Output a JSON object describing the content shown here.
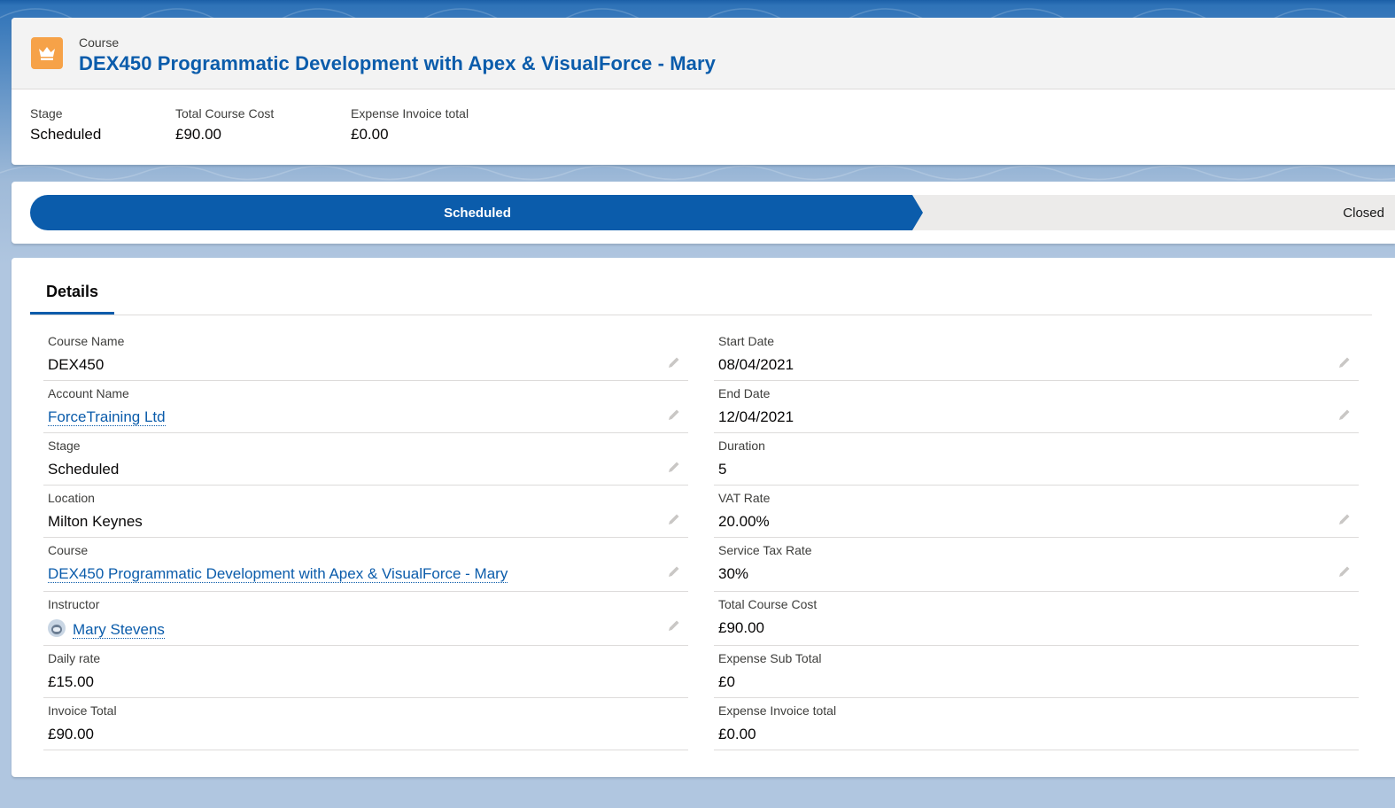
{
  "colors": {
    "brand_blue": "#0b5cab",
    "icon_orange": "#f6a248",
    "path_inactive": "#ecebea"
  },
  "header": {
    "object_icon": "crown-icon",
    "object_type": "Course",
    "title": "DEX450 Programmatic Development with Apex & VisualForce - Mary",
    "highlights": [
      {
        "label": "Stage",
        "value": "Scheduled"
      },
      {
        "label": "Total Course Cost",
        "value": "£90.00"
      },
      {
        "label": "Expense Invoice total",
        "value": "£0.00"
      }
    ]
  },
  "path": {
    "stages": [
      {
        "label": "Scheduled",
        "state": "current"
      },
      {
        "label": "Closed",
        "state": "incomplete"
      }
    ]
  },
  "details": {
    "tab_label": "Details",
    "left": [
      {
        "label": "Course Name",
        "value": "DEX450",
        "editable": true
      },
      {
        "label": "Account Name",
        "value": "ForceTraining Ltd",
        "link": true,
        "editable": true
      },
      {
        "label": "Stage",
        "value": "Scheduled",
        "editable": true
      },
      {
        "label": "Location",
        "value": "Milton Keynes",
        "editable": true
      },
      {
        "label": "Course",
        "value": "DEX450 Programmatic Development with Apex & VisualForce - Mary",
        "link": true,
        "editable": true
      },
      {
        "label": "Instructor",
        "value": "Mary Stevens",
        "link": true,
        "avatar": true,
        "editable": true
      },
      {
        "label": "Daily rate",
        "value": "£15.00",
        "editable": false
      },
      {
        "label": "Invoice Total",
        "value": "£90.00",
        "editable": false
      }
    ],
    "right": [
      {
        "label": "Start Date",
        "value": "08/04/2021",
        "editable": true
      },
      {
        "label": "End Date",
        "value": "12/04/2021",
        "editable": true
      },
      {
        "label": "Duration",
        "value": "5",
        "editable": false
      },
      {
        "label": "VAT Rate",
        "value": "20.00%",
        "editable": true
      },
      {
        "label": "Service Tax Rate",
        "value": "30%",
        "editable": true
      },
      {
        "label": "Total Course Cost",
        "value": "£90.00",
        "editable": false
      },
      {
        "label": "Expense Sub Total",
        "value": "£0",
        "editable": false
      },
      {
        "label": "Expense Invoice total",
        "value": "£0.00",
        "editable": false
      }
    ]
  }
}
